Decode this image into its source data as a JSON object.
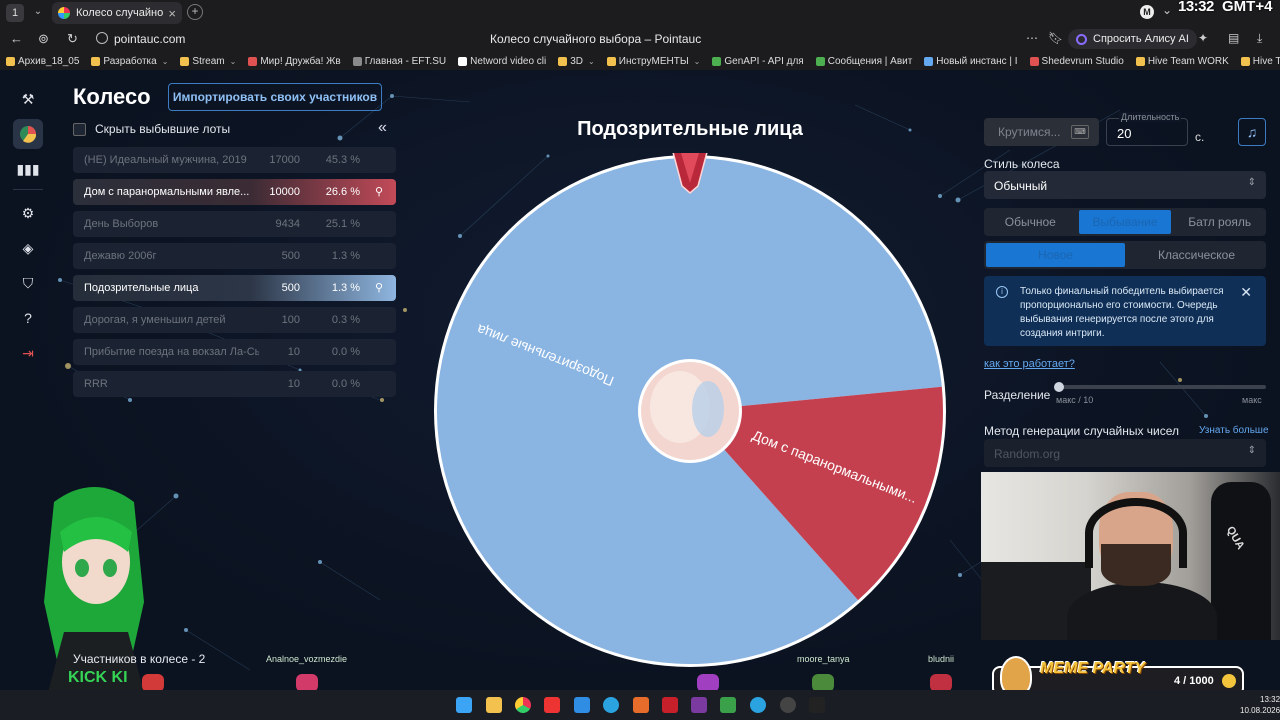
{
  "browser": {
    "workspace": "1",
    "tab_title": "Колесо случайного выбора – Pointauc",
    "url": "pointauc.com",
    "page_title": "Колесо случайного выбора – Pointauc",
    "alice_label": "Спросить Алису AI",
    "clock": "13:32",
    "timezone": "GMT+4",
    "bookmarks": [
      {
        "label": "Архив_18_05",
        "color": "#f2c14e",
        "dropdown": false
      },
      {
        "label": "Разработка",
        "color": "#f2c14e",
        "dropdown": true
      },
      {
        "label": "Stream",
        "color": "#f2c14e",
        "dropdown": true
      },
      {
        "label": "Мир! Дружба! Жв",
        "color": "#e05252",
        "dropdown": false
      },
      {
        "label": "Главная - EFT.SU",
        "color": "#8a8a8a",
        "dropdown": false
      },
      {
        "label": "Netword video cli",
        "color": "#ffffff",
        "dropdown": false
      },
      {
        "label": "3D",
        "color": "#f2c14e",
        "dropdown": true
      },
      {
        "label": "ИнструМЕНТЫ",
        "color": "#f2c14e",
        "dropdown": true
      },
      {
        "label": "GenAPI - API для",
        "color": "#4caf50",
        "dropdown": false
      },
      {
        "label": "Сообщения | Авит",
        "color": "#4caf50",
        "dropdown": false
      },
      {
        "label": "Новый инстанс | I",
        "color": "#64a8f0",
        "dropdown": false
      },
      {
        "label": "Shedevrum Studio",
        "color": "#e05252",
        "dropdown": false
      },
      {
        "label": "Hive Team WORK",
        "color": "#f2c14e",
        "dropdown": false
      },
      {
        "label": "Hive Team DEV",
        "color": "#f2c14e",
        "dropdown": false
      }
    ]
  },
  "sidebar": {
    "icons": [
      "gavel-icon",
      "wheel-icon",
      "stats-icon",
      "settings-icon",
      "layers-icon",
      "shield-icon",
      "help-icon",
      "logout-icon"
    ]
  },
  "panel": {
    "title": "Колесо",
    "import_label": "Импортировать своих участников",
    "hide_label": "Скрыть выбывшие лоты",
    "collapse_glyph": "«"
  },
  "lots": [
    {
      "name": "(НЕ) Идеальный мужчина, 2019",
      "amount": "17000",
      "percent": "45.3 %",
      "state": "out"
    },
    {
      "name": "Дом с паранормальными явле...",
      "amount": "10000",
      "percent": "26.6 %",
      "state": "red"
    },
    {
      "name": "День Выборов",
      "amount": "9434",
      "percent": "25.1 %",
      "state": "out"
    },
    {
      "name": "Дежавю 2006г",
      "amount": "500",
      "percent": "1.3 %",
      "state": "out"
    },
    {
      "name": "Подозрительные лица",
      "amount": "500",
      "percent": "1.3 %",
      "state": "blue"
    },
    {
      "name": "Дорогая, я уменьшил детей",
      "amount": "100",
      "percent": "0.3 %",
      "state": "out"
    },
    {
      "name": "Прибытие поезда на вокзал Ла-Сь...",
      "amount": "10",
      "percent": "0.0 %",
      "state": "out"
    },
    {
      "name": "RRR",
      "amount": "10",
      "percent": "0.0 %",
      "state": "out"
    }
  ],
  "wheel": {
    "title": "Подозрительные лица",
    "segments": [
      {
        "label": "Подозрительные лица",
        "value": 500,
        "color": "#8ab4e2"
      },
      {
        "label": "Дом с паранормальными...",
        "value": 88,
        "color": "#c4404f"
      }
    ]
  },
  "controls": {
    "spin_label": "Крутимся...",
    "spin_key": "⌨",
    "duration_label": "Длительность",
    "duration_value": "20",
    "duration_unit": "с.",
    "style_label": "Стиль колеса",
    "style_value": "Обычный",
    "modes": [
      "Обычное",
      "Выбывание",
      "Батл рояль"
    ],
    "active_mode": 1,
    "submodes": [
      "Новое",
      "Классическое"
    ],
    "active_submode": 0,
    "info_text": "Только финальный победитель выбирается пропорционально его стоимости. Очередь выбывания генерируется после этого для создания интриги.",
    "how_link": "как это работает?",
    "split_label": "Разделение",
    "split_min": "макс / 10",
    "split_max": "макс",
    "rng_label": "Метод генерации случайных чисел",
    "rng_learn": "Узнать больше",
    "rng_value": "Random.org"
  },
  "overlay": {
    "participants": "Участников в колесе - 2",
    "nicks": [
      "Analnoe_vozmezdie",
      "moore_tanya",
      "bludnii"
    ],
    "meme_title": "MEME PARTY",
    "meme_count": "4 / 1000",
    "webcam_text": "QUA"
  },
  "taskbar": {
    "time": "13:32",
    "date": "10.08.2026"
  }
}
